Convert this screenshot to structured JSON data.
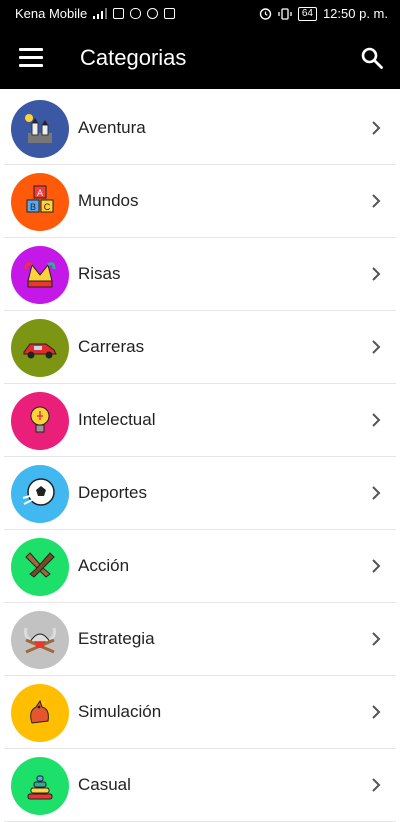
{
  "status": {
    "carrier": "Kena Mobile",
    "battery": "64",
    "time": "12:50 p. m."
  },
  "app_bar": {
    "title": "Categorias",
    "menu_icon": "hamburger-menu-icon",
    "search_icon": "search-icon"
  },
  "categories": [
    {
      "label": "Aventura",
      "color": "#3b58a5",
      "icon": "castle-icon"
    },
    {
      "label": "Mundos",
      "color": "#ff5a0a",
      "icon": "abc-blocks-icon"
    },
    {
      "label": "Risas",
      "color": "#c418e8",
      "icon": "jester-hat-icon"
    },
    {
      "label": "Carreras",
      "color": "#7c9613",
      "icon": "race-car-icon"
    },
    {
      "label": "Intelectual",
      "color": "#e91f7a",
      "icon": "lightbulb-icon"
    },
    {
      "label": "Deportes",
      "color": "#42b8f0",
      "icon": "soccer-ball-icon"
    },
    {
      "label": "Acción",
      "color": "#1de06a",
      "icon": "crossed-pistols-icon"
    },
    {
      "label": "Estrategia",
      "color": "#c2c2c2",
      "icon": "viking-helmet-icon"
    },
    {
      "label": "Simulación",
      "color": "#ffbe00",
      "icon": "rooster-icon"
    },
    {
      "label": "Casual",
      "color": "#1de06a",
      "icon": "stacking-rings-icon"
    }
  ]
}
